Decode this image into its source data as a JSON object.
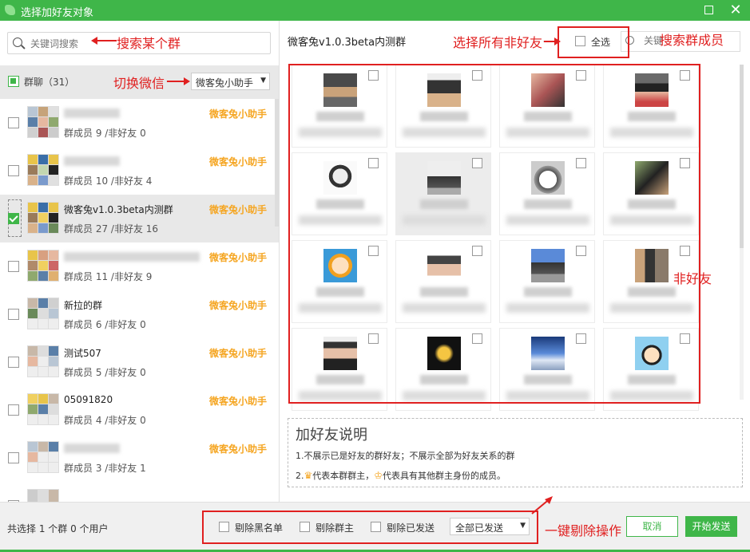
{
  "window": {
    "title": "选择加好友对象"
  },
  "left": {
    "search_placeholder": "关键词搜索",
    "header": {
      "label": "群聊（31）",
      "account": "微客兔小助手"
    },
    "groups": [
      {
        "name": "",
        "members": "群成员 9 /非好友 0",
        "owner": "微客兔小助手",
        "selected": false
      },
      {
        "name": "",
        "members": "群成员 10 /非好友 4",
        "owner": "微客兔小助手",
        "selected": false
      },
      {
        "name": "微客兔v1.0.3beta内测群",
        "members": "群成员 27 /非好友 16",
        "owner": "微客兔小助手",
        "selected": true
      },
      {
        "name": "",
        "members": "群成员 11 /非好友 9",
        "owner": "微客兔小助手",
        "selected": false
      },
      {
        "name": "新拉的群",
        "members": "群成员 6 /非好友 0",
        "owner": "微客兔小助手",
        "selected": false
      },
      {
        "name": "测试507",
        "members": "群成员 5 /非好友 0",
        "owner": "微客兔小助手",
        "selected": false
      },
      {
        "name": "05091820",
        "members": "群成员 4 /非好友 0",
        "owner": "微客兔小助手",
        "selected": false
      },
      {
        "name": "",
        "members": "群成员 3 /非好友 1",
        "owner": "微客兔小助手",
        "selected": false
      }
    ]
  },
  "right": {
    "group_title": "微客兔v1.0.3beta内测群",
    "select_all": "全选",
    "member_search_placeholder": "关键",
    "description": {
      "heading": "加好友说明",
      "line1": "1.不展示已是好友的群好友；不展示全部为好友关系的群",
      "line2_a": "2.",
      "line2_b": "代表本群群主，",
      "line2_c": "代表具有其他群主身份的成员。"
    }
  },
  "bottom": {
    "selection_info": "共选择 1 个群 0 个用户",
    "opt_blacklist": "剔除黑名单",
    "opt_owner": "剔除群主",
    "opt_sent": "剔除已发送",
    "sent_filter": "全部已发送",
    "cancel": "取消",
    "start": "开始发送"
  },
  "annotations": {
    "search_group": "搜索某个群",
    "switch_wechat": "切换微信",
    "select_all_nonfriend": "选择所有非好友",
    "search_member": "搜索群成员",
    "non_friend": "非好友",
    "one_click_remove": "一键剔除操作"
  },
  "colors": {
    "accent": "#3fb649",
    "owner": "#f5a623",
    "annotation": "#e02020"
  }
}
